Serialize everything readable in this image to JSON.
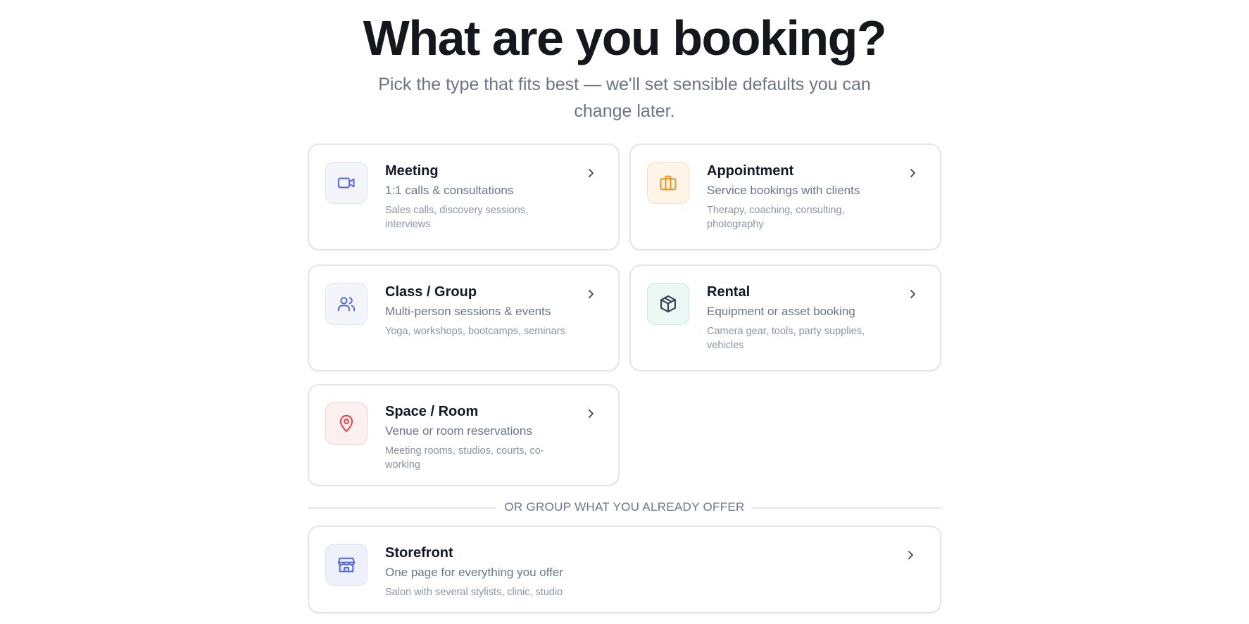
{
  "header": {
    "title": "What are you booking?",
    "subtitle": "Pick the type that fits best — we'll set sensible defaults you can change later."
  },
  "types": [
    {
      "title": "Meeting",
      "subtitle": "1:1 calls & consultations",
      "examples": "Sales calls, discovery sessions, interviews",
      "icon": "video-camera-icon",
      "color": "#5b6bd6"
    },
    {
      "title": "Appointment",
      "subtitle": "Service bookings with clients",
      "examples": "Therapy, coaching, consulting, photography",
      "icon": "briefcase-icon",
      "color": "#f0961f"
    },
    {
      "title": "Class / Group",
      "subtitle": "Multi-person sessions & events",
      "examples": "Yoga, workshops, bootcamps, seminars",
      "icon": "users-icon",
      "color": "#5b6bd6"
    },
    {
      "title": "Rental",
      "subtitle": "Equipment or asset booking",
      "examples": "Camera gear, tools, party supplies, vehicles",
      "icon": "package-box-icon",
      "color": "#374151"
    },
    {
      "title": "Space / Room",
      "subtitle": "Venue or room reservations",
      "examples": "Meeting rooms, studios, courts, co-working",
      "icon": "map-pin-icon",
      "color": "#e5414f"
    }
  ],
  "divider": {
    "label": "OR GROUP WHAT YOU ALREADY OFFER"
  },
  "storefront": {
    "title": "Storefront",
    "subtitle": "One page for everything you offer",
    "examples": "Salon with several stylists, clinic, studio",
    "icon": "storefront-icon",
    "color": "#5b6bd6"
  }
}
